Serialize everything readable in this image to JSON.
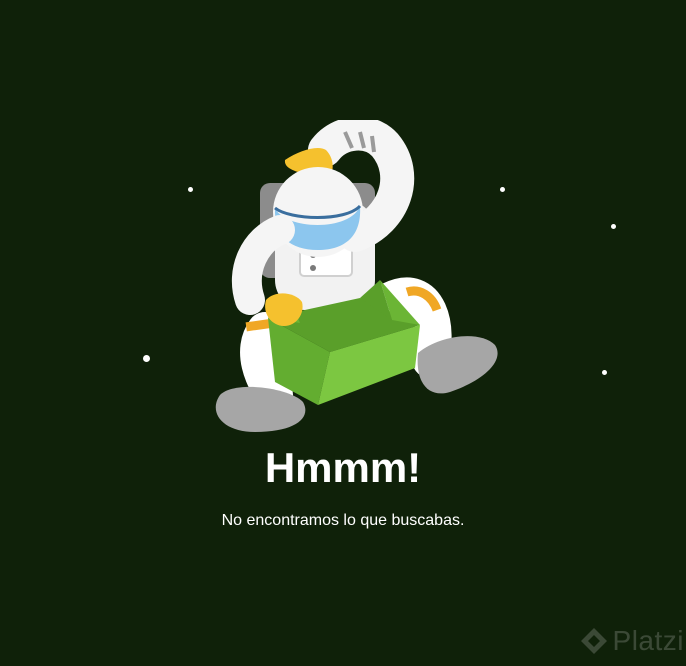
{
  "error_page": {
    "title": "Hmmm!",
    "message": "No encontramos lo que buscabas."
  },
  "illustration": {
    "icon": "astronaut-with-box-illustration"
  },
  "watermark": {
    "text": "Platzi",
    "icon": "platzi-logo-icon"
  },
  "colors": {
    "background": "#0f2109",
    "box_green": "#78c43e",
    "helmet_visor": "#8cc6ee",
    "glove_yellow": "#f5c12e",
    "text": "#ffffff"
  }
}
